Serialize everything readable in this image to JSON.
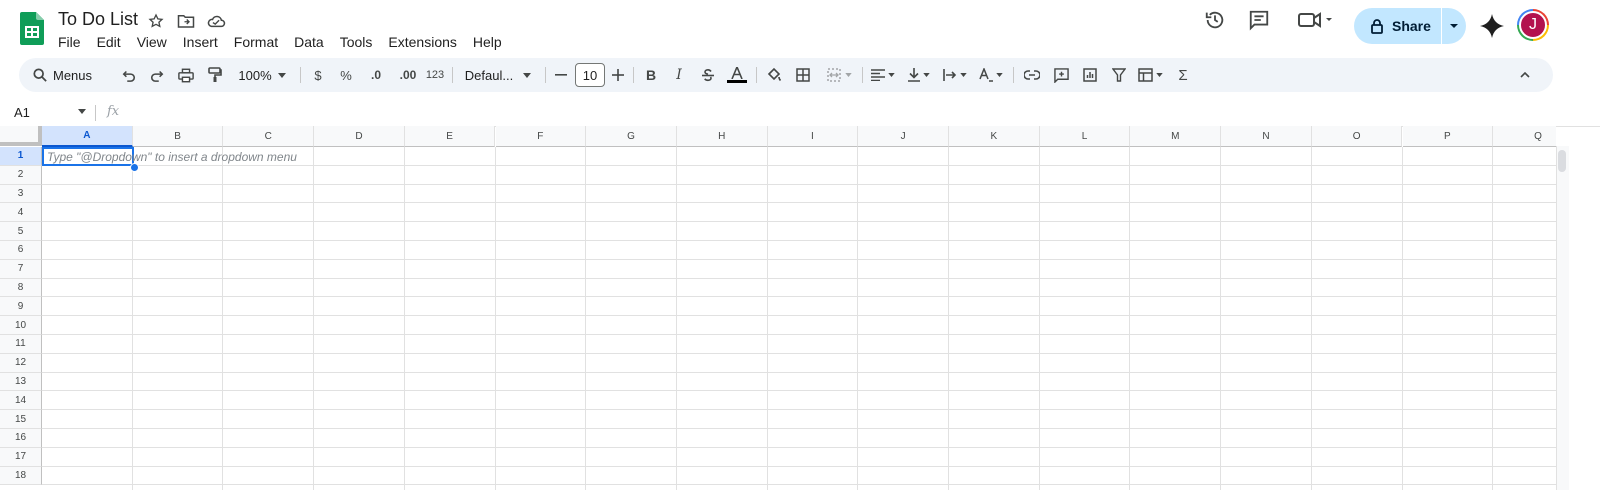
{
  "doc": {
    "title": "To Do List"
  },
  "menu": [
    "File",
    "Edit",
    "View",
    "Insert",
    "Format",
    "Data",
    "Tools",
    "Extensions",
    "Help"
  ],
  "header": {
    "share_label": "Share",
    "avatar_letter": "J"
  },
  "toolbar": {
    "menus_label": "Menus",
    "zoom": "100%",
    "currency": "$",
    "percent": "%",
    "dec_decrease": ".0",
    "dec_increase": ".00",
    "number_format": "123",
    "font": "Defaul...",
    "font_size": "10"
  },
  "formula_bar": {
    "cell_ref": "A1",
    "fx": "fx"
  },
  "sheet": {
    "columns": [
      "A",
      "B",
      "C",
      "D",
      "E",
      "F",
      "G",
      "H",
      "I",
      "J",
      "K",
      "L",
      "M",
      "N",
      "O",
      "P",
      "Q"
    ],
    "rows": [
      "1",
      "2",
      "3",
      "4",
      "5",
      "6",
      "7",
      "8",
      "9",
      "10",
      "11",
      "12",
      "13",
      "14",
      "15",
      "16",
      "17",
      "18"
    ],
    "selected_cell_hint": "Type \"@Dropdown\"  to insert a dropdown menu"
  },
  "colors": {
    "accent": "#1a73e8",
    "share_bg": "#c2e7ff",
    "toolbar_bg": "#f0f4f9"
  }
}
